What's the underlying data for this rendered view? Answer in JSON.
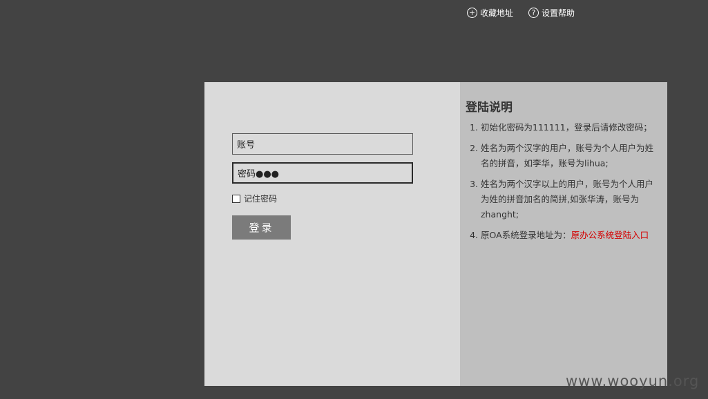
{
  "header": {
    "favorite_label": "收藏地址",
    "favorite_icon": "plus-circle-icon",
    "help_label": "设置帮助",
    "help_icon": "question-circle-icon"
  },
  "login": {
    "username_value": "账号",
    "password_value": "密码●●●",
    "remember_label": "记住密码",
    "remember_checked": false,
    "submit_label": "登录"
  },
  "instructions": {
    "title": "登陆说明",
    "items": [
      "初始化密码为111111，登录后请修改密码；",
      "姓名为两个汉字的用户，账号为个人用户为姓名的拼音，如李华，账号为lihua;",
      "姓名为两个汉字以上的用户，账号为个人用户为姓的拼音加名的简拼,如张华涛，账号为zhanght;"
    ],
    "item4_prefix": "原OA系统登录地址为：",
    "item4_link": "原办公系统登陆入口"
  },
  "watermark": "www.wooyun.org",
  "colors": {
    "background": "#434343",
    "form_panel": "#dadada",
    "info_panel": "#bfbfbf",
    "button": "#7b7b7b",
    "link": "#d40000"
  }
}
